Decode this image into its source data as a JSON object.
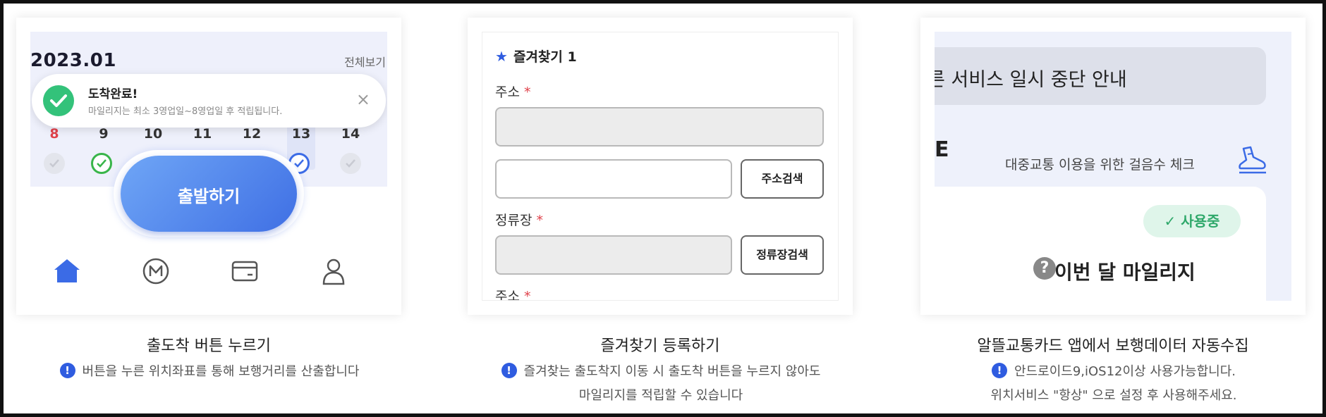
{
  "panel1": {
    "calendar": {
      "month": "2023.01",
      "view_all": "전체보기",
      "days": [
        "8",
        "9",
        "10",
        "11",
        "12",
        "13",
        "14"
      ]
    },
    "toast": {
      "title": "도착완료!",
      "subtitle": "마일리지는 최소 3영업일~8영업일 후 적립됩니다.",
      "close": "×"
    },
    "depart_button": "출발하기",
    "nav_icons": [
      "home-icon",
      "mileage-icon",
      "card-icon",
      "user-icon"
    ],
    "caption_title": "출도착 버튼 누르기",
    "caption_desc": "버튼을 누른 위치좌표를 통해 보행거리를 산출합니다"
  },
  "panel2": {
    "favorite_title": "즐겨찾기 1",
    "address_label": "주소",
    "required_mark": "*",
    "address_search_button": "주소검색",
    "stop_label": "정류장",
    "stop_search_button": "정류장검색",
    "address_label2": "주소",
    "caption_title": "즐겨찾기 등록하기",
    "caption_desc_line1": "즐겨찾는 출도착지 이동 시 출도착 버튼을 누르지 않아도",
    "caption_desc_line2": "마일리지를 적립할 수 있습니다"
  },
  "panel3": {
    "notice": "른 서비스 일시 중단 안내",
    "partial_glyph": "E",
    "walk_check": "대중교통 이용을 위한 걸음수 체크",
    "in_use_badge": "✓ 사용중",
    "mileage_title": "이번 달 마일리지",
    "help_mark": "?",
    "caption_title": "알뜰교통카드 앱에서 보행데이터 자동수집",
    "caption_desc_line1": "안드로이드9,iOS12이상 사용가능합니다.",
    "caption_desc_line2": "위치서비스 \"항상\" 으로 설정 후 사용해주세요."
  },
  "alert_mark": "!",
  "colors": {
    "accent": "#2f5ce0",
    "required": "#e0424b",
    "success": "#33c27a",
    "in_use": "#2ea86a"
  }
}
